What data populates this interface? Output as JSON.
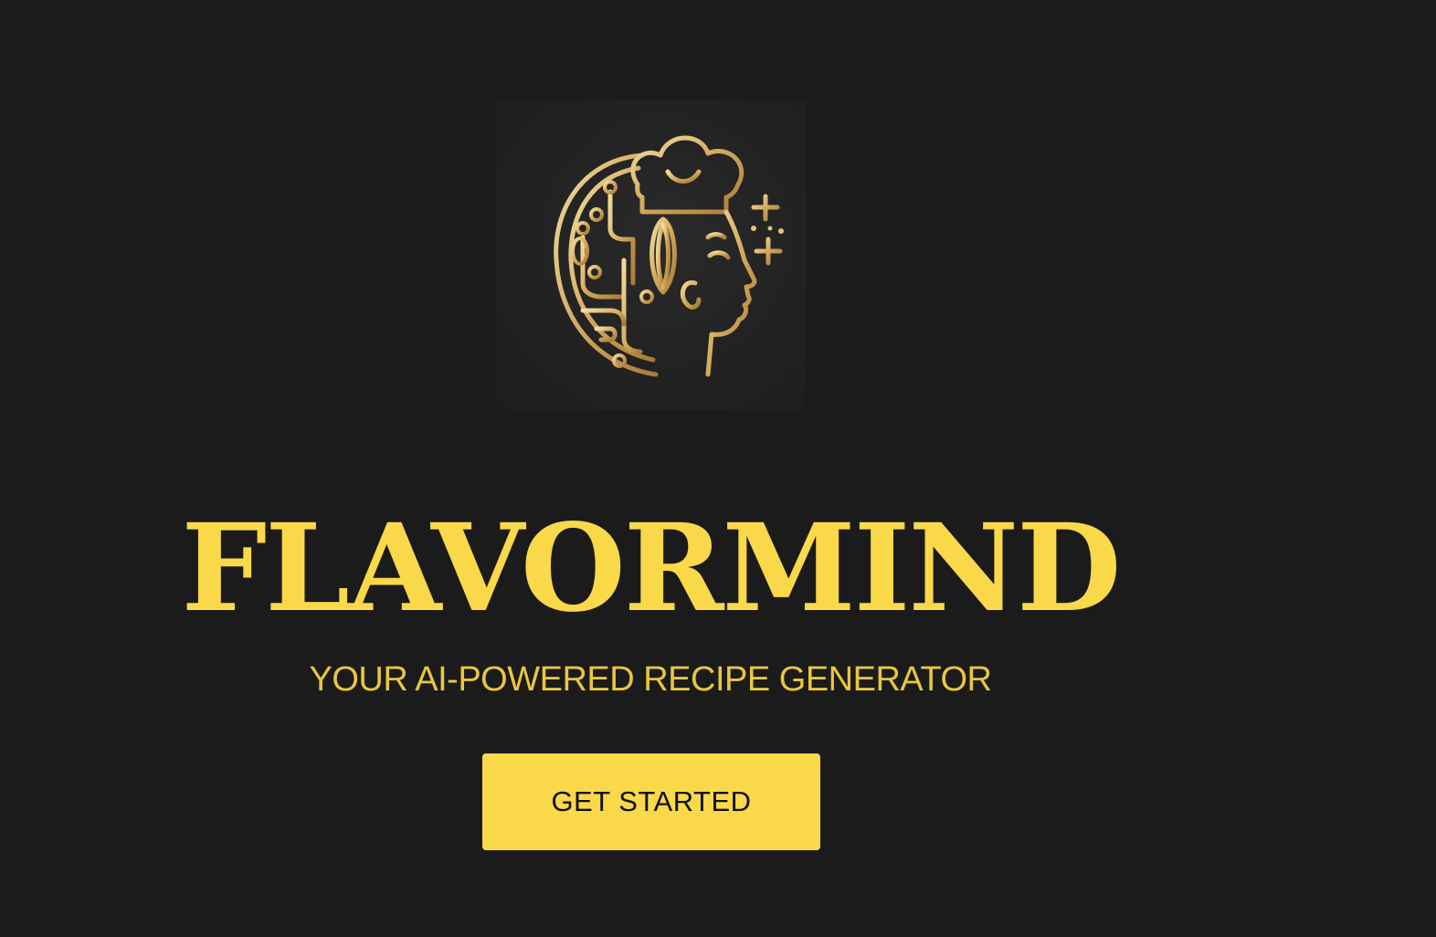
{
  "brand": {
    "title": "FLAVORMIND",
    "subtitle": "YOUR AI-POWERED RECIPE GENERATOR",
    "logo_icon": "chef-head-circuit-logo-icon"
  },
  "cta": {
    "label": "GET STARTED"
  },
  "colors": {
    "background": "#1b1b1b",
    "accent": "#f9d84a",
    "logo_gold": "#d9b56d"
  }
}
